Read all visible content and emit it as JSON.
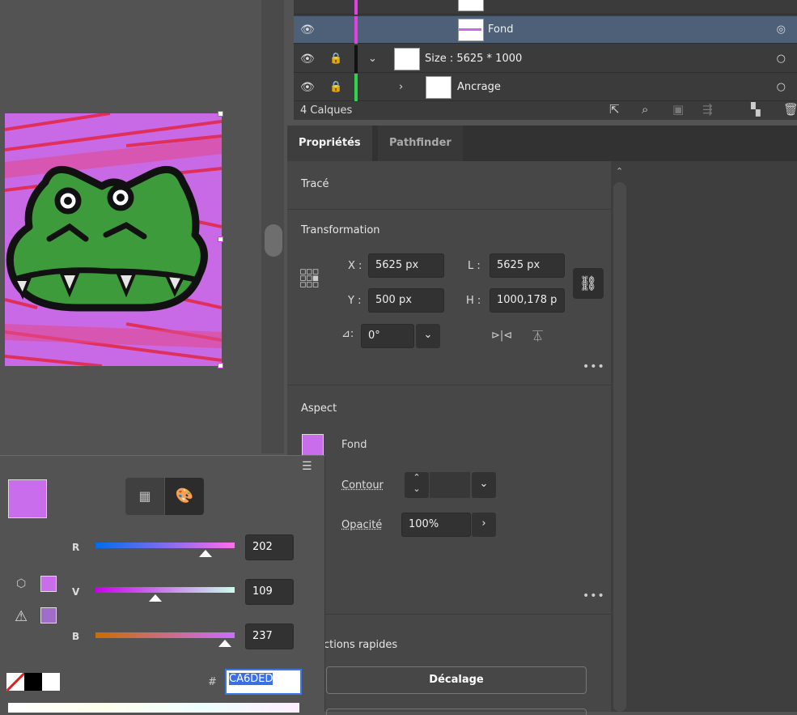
{
  "layers": {
    "rows": [
      {
        "name": "Fond",
        "selected": true
      },
      {
        "name": "Size : 5625 * 1000",
        "selected": false
      },
      {
        "name": "Ancrage",
        "selected": false
      }
    ],
    "count_label": "4 Calques"
  },
  "tabs": [
    {
      "label": "Propriétés",
      "active": true
    },
    {
      "label": "Pathfinder",
      "active": false
    }
  ],
  "properties": {
    "trace_title": "Tracé",
    "transform": {
      "title": "Transformation",
      "x_label": "X :",
      "x_value": "5625 px",
      "y_label": "Y :",
      "y_value": "500 px",
      "l_label": "L :",
      "l_value": "5625 px",
      "h_label": "H :",
      "h_value": "1000,178 p",
      "angle_value": "0°",
      "more": "•••"
    },
    "aspect": {
      "title": "Aspect",
      "fill_label": "Fond",
      "fill_color": "#CA6DED",
      "stroke_label": "Contour",
      "opacity_label": "Opacité",
      "opacity_value": "100%",
      "more": "•••"
    },
    "quick_actions": {
      "title": "ctions rapides",
      "offset_button": "Décalage"
    }
  },
  "color_panel": {
    "current_color": "#CA6DED",
    "r_label": "R",
    "r_value": "202",
    "v_label": "V",
    "v_value": "109",
    "b_label": "B",
    "b_value": "237",
    "hash": "#",
    "hex_value": "CA6DED"
  },
  "artwork": {
    "background_color": "#CA6DED",
    "accent_stripe_color": "#E0305A",
    "croc_green": "#3E9B3C"
  }
}
